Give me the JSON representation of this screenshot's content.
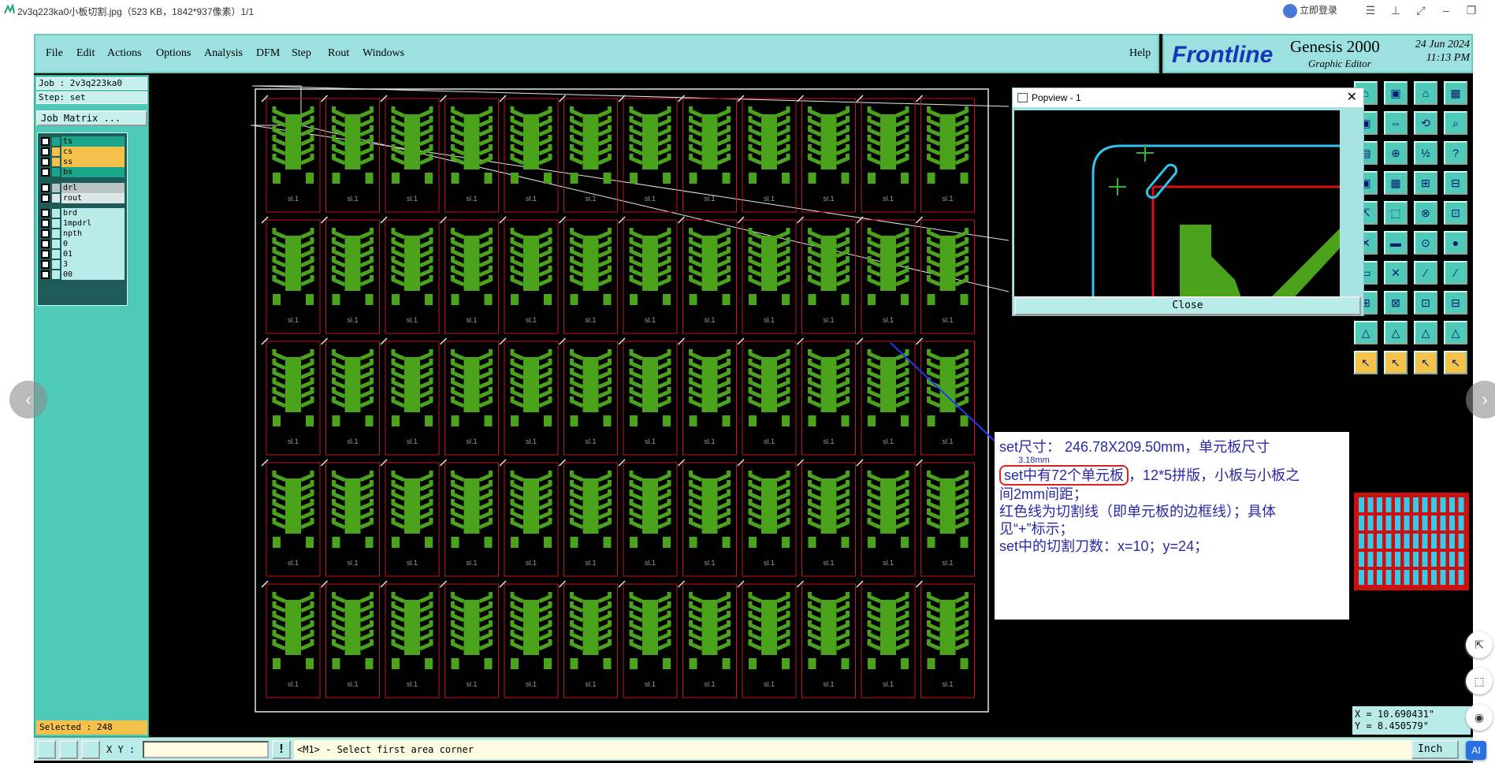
{
  "viewer": {
    "title": "2v3q223ka0小板切割.jpg（523 KB，1842*937像素）1/1",
    "login": "立即登录",
    "prev": "‹",
    "next": "›",
    "ai_badge": "AI"
  },
  "menu": {
    "items": [
      "File",
      "Edit",
      "Actions",
      "Options",
      "Analysis",
      "DFM",
      "Step",
      "Rout",
      "Windows"
    ],
    "help": "Help"
  },
  "brand": {
    "logo": "Frontline",
    "product": "Genesis 2000",
    "subtitle": "Graphic Editor",
    "date": "24 Jun 2024",
    "time": "11:13 PM"
  },
  "job": {
    "job_line": "Job : 2v3q223ka0",
    "step_line": "Step: set",
    "matrix_button": "Job Matrix ...",
    "selected": "Selected : 248"
  },
  "layers": [
    {
      "name": "ts",
      "color": "#1aa58a"
    },
    {
      "name": "cs",
      "color": "#f4c14b"
    },
    {
      "name": "ss",
      "color": "#f4c14b"
    },
    {
      "name": "bs",
      "color": "#1aa58a"
    },
    {
      "name": "drl",
      "color": "#b9c4c4"
    },
    {
      "name": "rout",
      "color": "#dde6e6"
    },
    {
      "name": "brd",
      "color": "#b9ece8"
    },
    {
      "name": "1mpdrl",
      "color": "#b9ece8"
    },
    {
      "name": "npth",
      "color": "#b9ece8"
    },
    {
      "name": "0",
      "color": "#b9ece8"
    },
    {
      "name": "01",
      "color": "#b9ece8"
    },
    {
      "name": "3",
      "color": "#b9ece8"
    },
    {
      "name": "00",
      "color": "#b9ece8"
    }
  ],
  "board": {
    "rows": 5,
    "cols": 12,
    "unit_label": "sl.1"
  },
  "popview": {
    "title": "Popview - 1",
    "close": "Close"
  },
  "note": {
    "line1": "set尺寸： 246.78X209.50mm，单元板尺寸",
    "line1b": "3.18mm",
    "line2a": "set中有72个单元板",
    "line2b": "，12*5拼版，小板与小板之",
    "line3": "间2mm间距；",
    "line4": "红色线为切割线（即单元板的边框线）；具体",
    "line5": "见“+”标示；",
    "line6": "set中的切割刀数：x=10；y=24；"
  },
  "coords": {
    "x": "X = 10.690431\"",
    "y": "Y = 8.450579\""
  },
  "status": {
    "xy_label": "X Y :",
    "xy_value": "",
    "message": "<M1> - Select first area corner",
    "unit": "Inch"
  }
}
